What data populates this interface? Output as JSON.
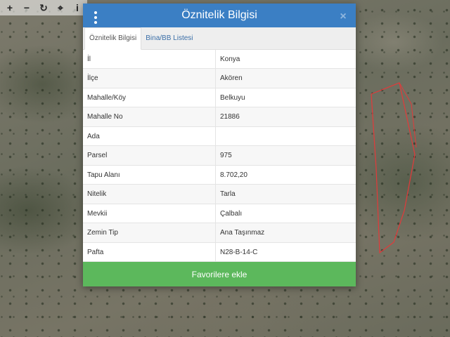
{
  "map": {
    "toolbar": [
      {
        "name": "zoom-in-icon",
        "glyph": "+"
      },
      {
        "name": "zoom-out-icon",
        "glyph": "−"
      },
      {
        "name": "refresh-icon",
        "glyph": "↻"
      },
      {
        "name": "locate-icon",
        "glyph": "⌖"
      },
      {
        "name": "info-icon",
        "glyph": "i"
      }
    ],
    "parcel_color": "#e23a3a"
  },
  "modal": {
    "title": "Öznitelik Bilgisi",
    "close_glyph": "×",
    "tabs": [
      {
        "label": "Öznitelik Bilgisi",
        "active": true
      },
      {
        "label": "Bina/BB Listesi",
        "active": false
      }
    ],
    "rows": [
      {
        "key": "İl",
        "value": "Konya"
      },
      {
        "key": "İlçe",
        "value": "Akören"
      },
      {
        "key": "Mahalle/Köy",
        "value": "Belkuyu"
      },
      {
        "key": "Mahalle No",
        "value": "21886"
      },
      {
        "key": "Ada",
        "value": ""
      },
      {
        "key": "Parsel",
        "value": "975"
      },
      {
        "key": "Tapu Alanı",
        "value": "8.702,20"
      },
      {
        "key": "Nitelik",
        "value": "Tarla"
      },
      {
        "key": "Mevkii",
        "value": "Çalbalı"
      },
      {
        "key": "Zemin Tip",
        "value": "Ana Taşınmaz"
      },
      {
        "key": "Pafta",
        "value": "N28-B-14-C"
      }
    ],
    "favorite_button": "Favorilere ekle",
    "colors": {
      "header": "#3b7fc4",
      "button": "#5cb85c"
    }
  }
}
